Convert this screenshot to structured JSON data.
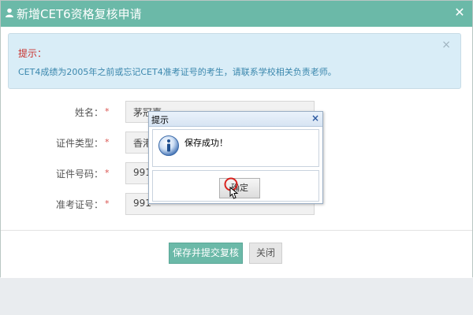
{
  "modal": {
    "title": "新增CET6资格复核申请",
    "colors": {
      "header": "#6bb9a8",
      "tip_bg": "#d9edf7",
      "required": "#d9534f"
    }
  },
  "tip": {
    "title": "提示：",
    "text": "CET4成绩为2005年之前或忘记CET4准考证号的考生，请联系学校相关负责老师。"
  },
  "form": {
    "name_label": "姓名：",
    "name_value": "茅冠嘉",
    "id_type_label": "证件类型：",
    "id_type_value": "香港",
    "id_number_label": "证件号码：",
    "id_number_value": "991",
    "exam_number_label": "准考证号：",
    "exam_number_value": "991",
    "required_mark": "*"
  },
  "footer": {
    "submit_label": "保存并提交复核",
    "close_label": "关闭"
  },
  "alert": {
    "title": "提示",
    "message": "保存成功！",
    "ok_label": "确定",
    "icon": "info-icon"
  }
}
